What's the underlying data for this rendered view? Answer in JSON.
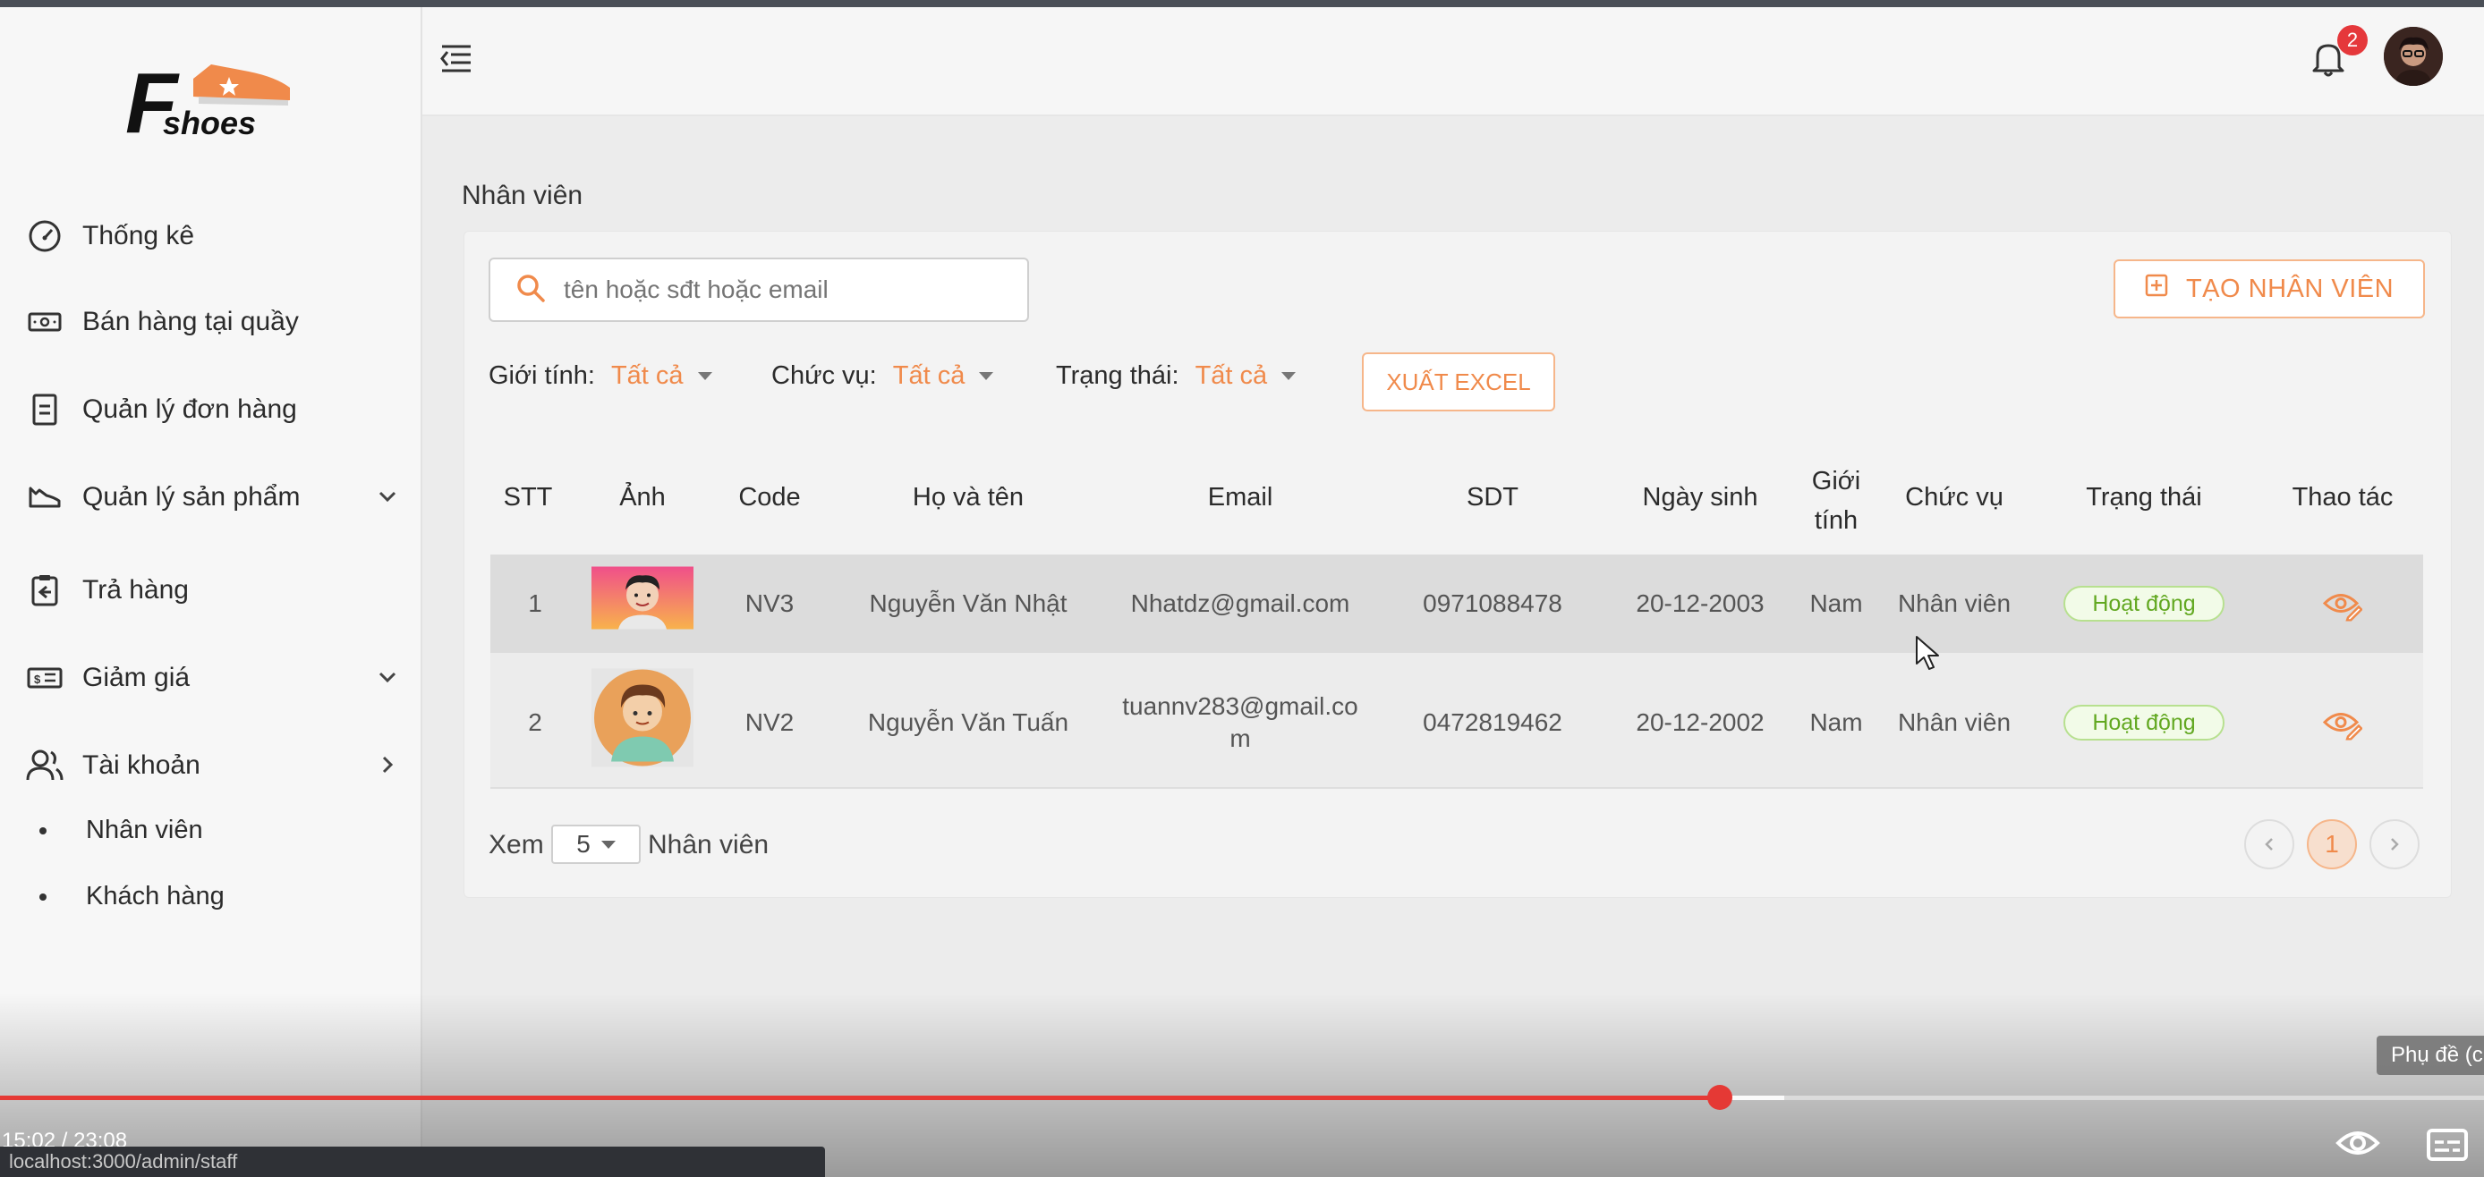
{
  "app": {
    "logo_letter": "F",
    "logo_text": "shoes"
  },
  "sidebar": {
    "items": [
      {
        "label": "Thống kê",
        "icon": "gauge-icon"
      },
      {
        "label": "Bán hàng tại quầy",
        "icon": "cash-icon"
      },
      {
        "label": "Quản lý đơn hàng",
        "icon": "document-icon"
      },
      {
        "label": "Quản lý sản phẩm",
        "icon": "shoe-icon",
        "chevron": "down"
      },
      {
        "label": "Trả hàng",
        "icon": "return-icon"
      },
      {
        "label": "Giảm giá",
        "icon": "discount-icon",
        "chevron": "down"
      },
      {
        "label": "Tài khoản",
        "icon": "users-icon",
        "chevron": "right"
      }
    ],
    "sub_items": [
      "Nhân viên",
      "Khách hàng"
    ]
  },
  "header": {
    "notification_count": "2"
  },
  "page": {
    "title": "Nhân viên",
    "search_placeholder": "tên hoặc sđt hoặc email",
    "create_button": "TẠO NHÂN VIÊN",
    "export_button": "XUẤT EXCEL",
    "filters": [
      {
        "label": "Giới tính:",
        "value": "Tất cả"
      },
      {
        "label": "Chức vụ:",
        "value": "Tất cả"
      },
      {
        "label": "Trạng thái:",
        "value": "Tất cả"
      }
    ]
  },
  "table": {
    "columns": [
      "STT",
      "Ảnh",
      "Code",
      "Họ và tên",
      "Email",
      "SDT",
      "Ngày sinh",
      "Giới tính",
      "Chức vụ",
      "Trạng thái",
      "Thao tác"
    ],
    "gender_header_line1": "Giới",
    "gender_header_line2": "tính",
    "rows": [
      {
        "stt": "1",
        "code": "NV3",
        "name": "Nguyễn Văn Nhật",
        "email": "Nhatdz@gmail.com",
        "phone": "0971088478",
        "dob": "20-12-2003",
        "gender": "Nam",
        "role": "Nhân viên",
        "status": "Hoạt động"
      },
      {
        "stt": "2",
        "code": "NV2",
        "name": "Nguyễn Văn Tuấn",
        "email_line1": "tuannv283@gmail.co",
        "email_line2": "m",
        "phone": "0472819462",
        "dob": "20-12-2002",
        "gender": "Nam",
        "role": "Nhân viên",
        "status": "Hoạt động"
      }
    ]
  },
  "pagination": {
    "prefix": "Xem",
    "page_size": "5",
    "suffix": "Nhân viên",
    "current_page": "1"
  },
  "video": {
    "time": "15:02 / 23:08",
    "progress_fraction": 0.65,
    "url": "localhost:3000/admin/staff",
    "subtitle_label": "Phụ đề (c"
  },
  "colors": {
    "accent": "#f08a4b",
    "status_green": "#62a821",
    "progress_red": "#e53935"
  }
}
